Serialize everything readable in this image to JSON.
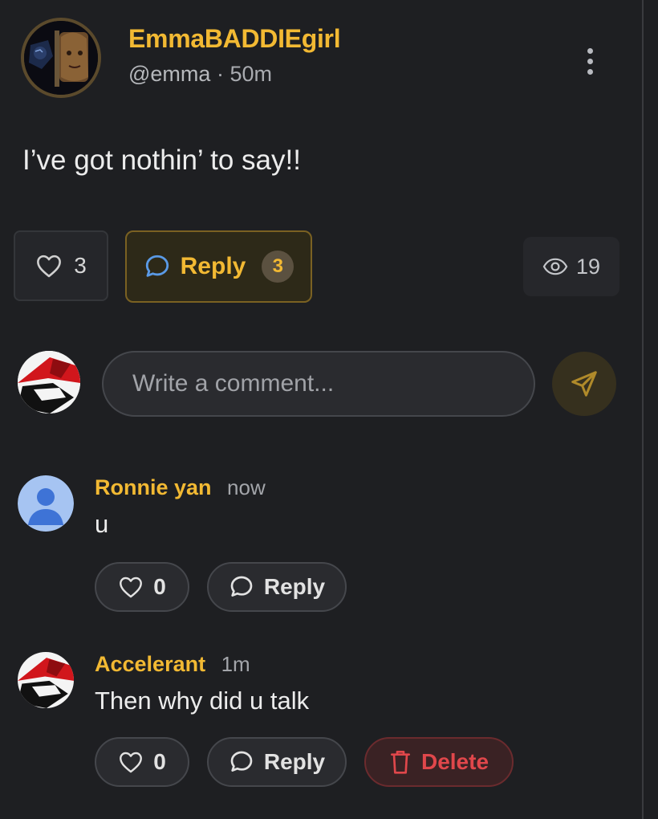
{
  "post": {
    "author_name": "EmmaBADDIEgirl",
    "handle": "@emma",
    "separator": "·",
    "time": "50m",
    "text": "I’ve got nothin’ to say!!",
    "likes": "3",
    "reply_label": "Reply",
    "reply_count": "3",
    "views": "19"
  },
  "composer": {
    "placeholder": "Write a comment..."
  },
  "comments": [
    {
      "author": "Ronnie yan",
      "time": "now",
      "text": "u",
      "likes": "0",
      "reply_label": "Reply"
    },
    {
      "author": "Accelerant",
      "time": "1m",
      "text": "Then why did u talk",
      "likes": "0",
      "reply_label": "Reply",
      "delete_label": "Delete"
    }
  ],
  "colors": {
    "accent": "#f2b933",
    "danger": "#e0474b",
    "background": "#1e1f22"
  },
  "icons": [
    "more-vertical-icon",
    "heart-icon",
    "chat-bubble-icon",
    "eye-icon",
    "send-icon",
    "trash-icon",
    "default-user-avatar"
  ]
}
